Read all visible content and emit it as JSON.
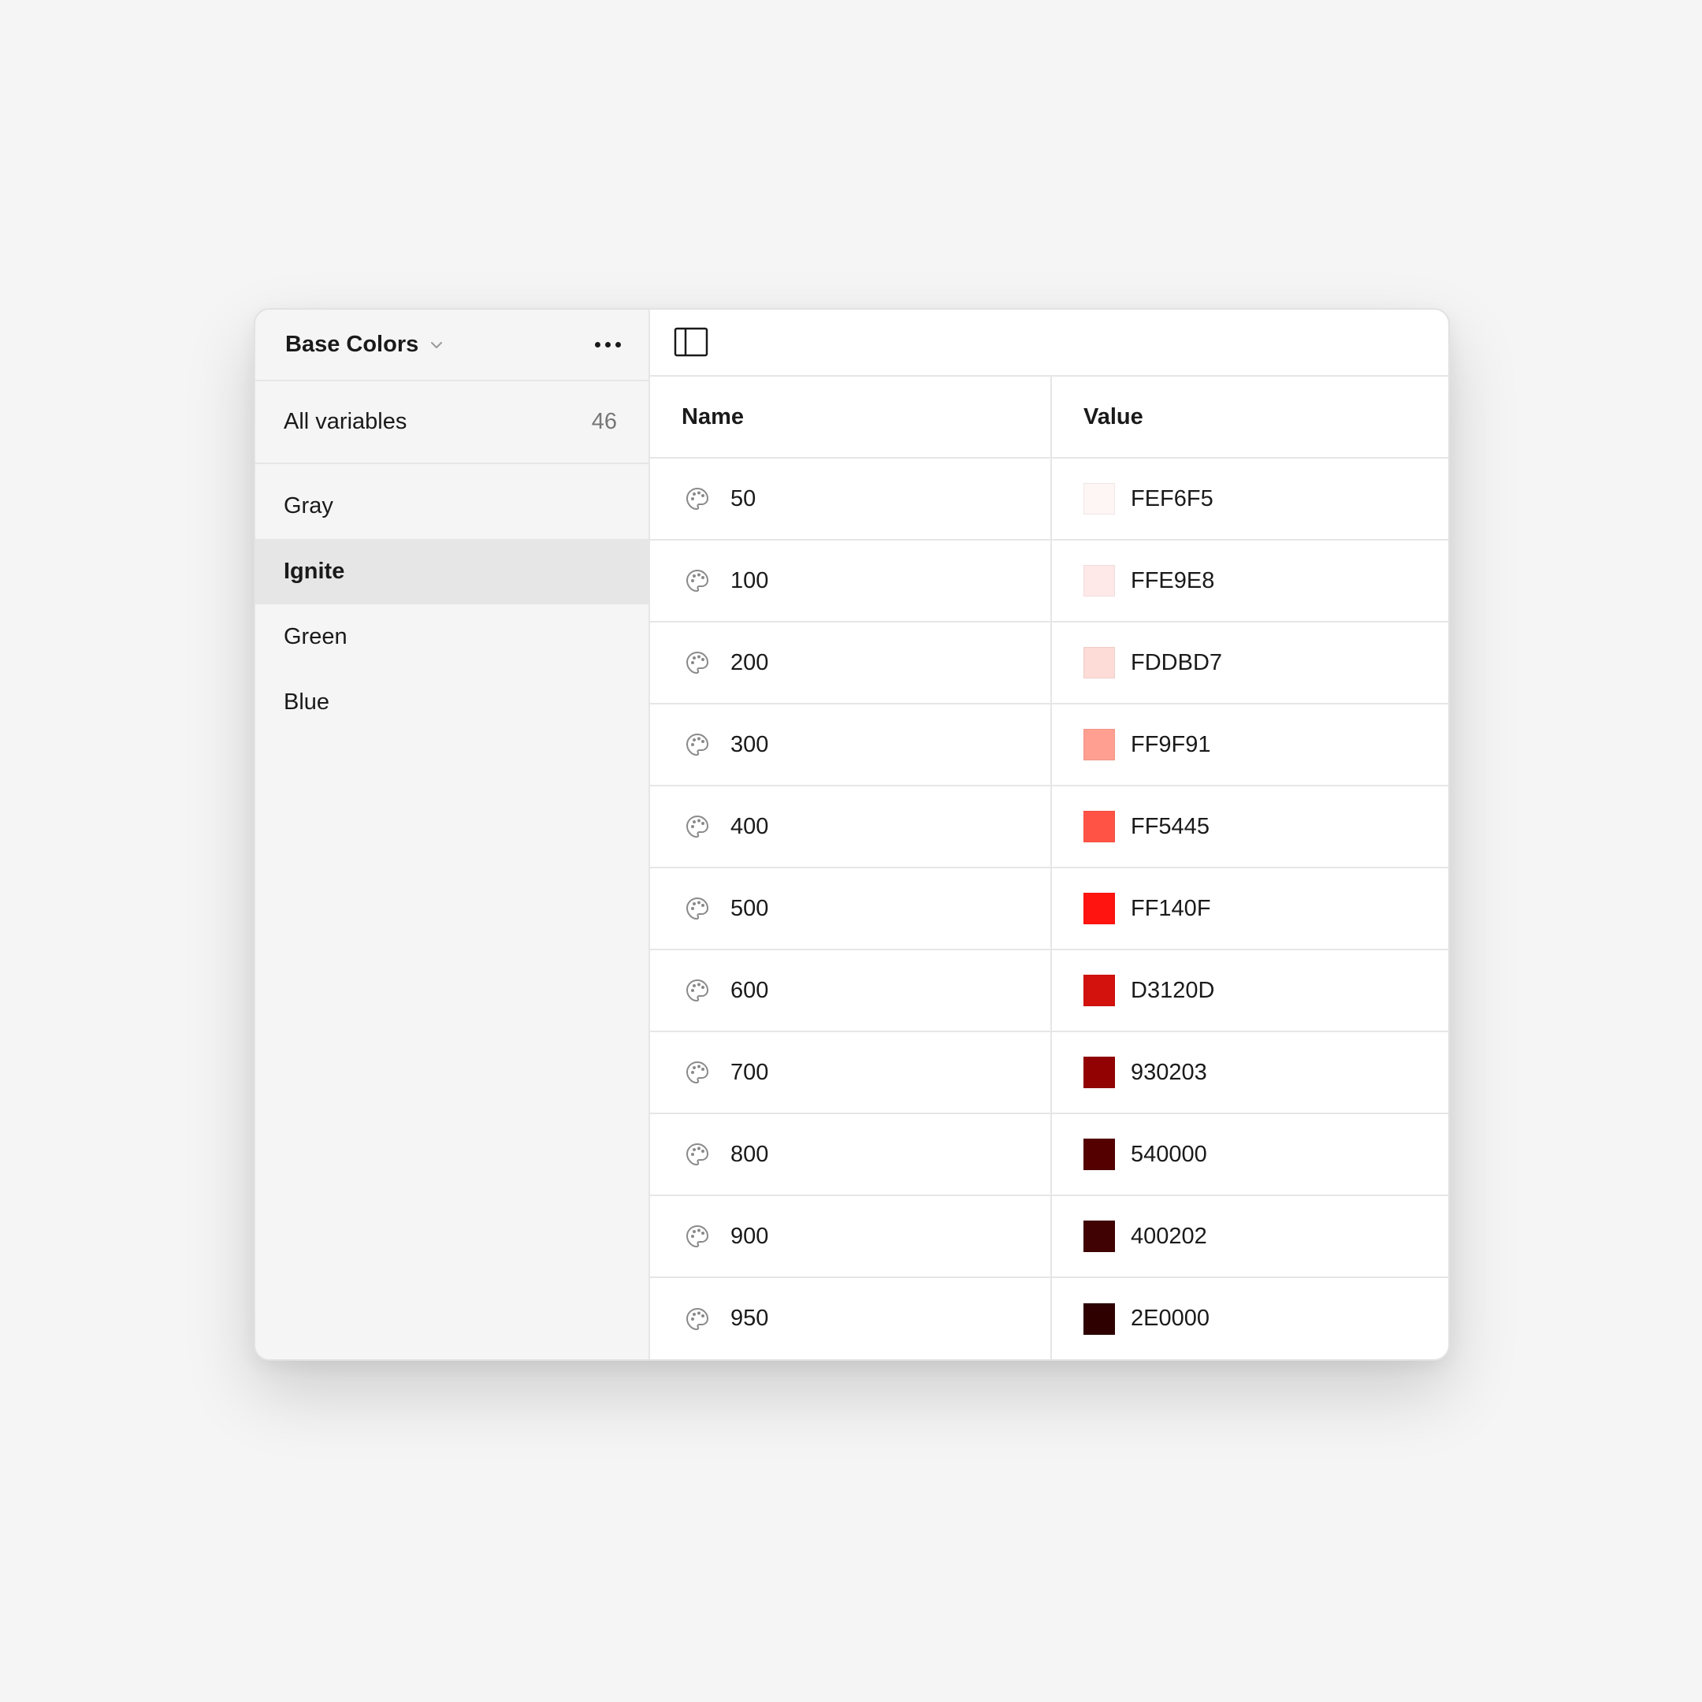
{
  "collection": {
    "title": "Base Colors"
  },
  "sidebar": {
    "all_variables": {
      "label": "All variables",
      "count": "46"
    },
    "groups": [
      {
        "label": "Gray"
      },
      {
        "label": "Ignite"
      },
      {
        "label": "Green"
      },
      {
        "label": "Blue"
      }
    ],
    "active_group": "Ignite"
  },
  "table": {
    "columns": {
      "name": "Name",
      "value": "Value"
    },
    "rows": [
      {
        "name": "50",
        "value": "FEF6F5",
        "color": "#FEF6F5",
        "icon": "palette-icon"
      },
      {
        "name": "100",
        "value": "FFE9E8",
        "color": "#FFE9E8",
        "icon": "palette-icon"
      },
      {
        "name": "200",
        "value": "FDDBD7",
        "color": "#FDDBD7",
        "icon": "palette-icon"
      },
      {
        "name": "300",
        "value": "FF9F91",
        "color": "#FF9F91",
        "icon": "palette-icon"
      },
      {
        "name": "400",
        "value": "FF5445",
        "color": "#FF5445",
        "icon": "palette-icon"
      },
      {
        "name": "500",
        "value": "FF140F",
        "color": "#FF140F",
        "icon": "palette-icon"
      },
      {
        "name": "600",
        "value": "D3120D",
        "color": "#D3120D",
        "icon": "palette-icon"
      },
      {
        "name": "700",
        "value": "930203",
        "color": "#930203",
        "icon": "palette-icon"
      },
      {
        "name": "800",
        "value": "540000",
        "color": "#540000",
        "icon": "palette-icon"
      },
      {
        "name": "900",
        "value": "400202",
        "color": "#400202",
        "icon": "palette-icon"
      },
      {
        "name": "950",
        "value": "2E0000",
        "color": "#2E0000",
        "icon": "palette-icon"
      }
    ]
  },
  "icons": {
    "collection_dropdown": "chevron-down-icon",
    "more": "more-horizontal-icon",
    "toggle_sidebar": "sidebar-toggle-icon"
  }
}
